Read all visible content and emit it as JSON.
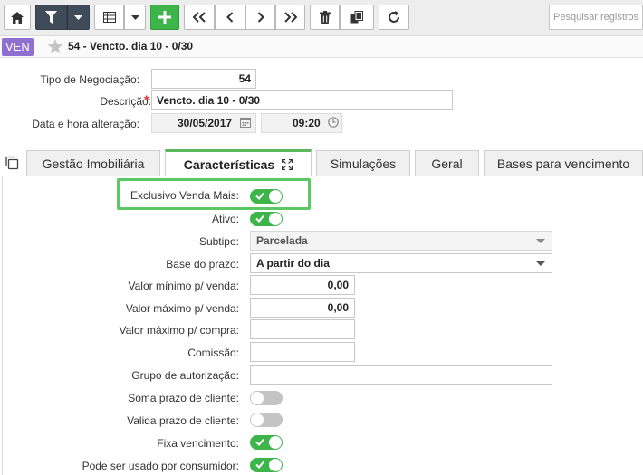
{
  "toolbar": {
    "search_placeholder": "Pesquisar registros..."
  },
  "titlebar": {
    "badge": "VEN",
    "title": "54 - Vencto. dia 10 - 0/30"
  },
  "header": {
    "tipo_label": "Tipo de Negociação:",
    "tipo_value": "54",
    "descricao_label": "Descrição:",
    "descricao_required": "*",
    "descricao_value": "Vencto. dia 10 - 0/30",
    "data_label": "Data e hora alteração:",
    "data_value": "30/05/2017",
    "hora_value": "09:20"
  },
  "tabs": [
    {
      "label": "Gestão Imobiliária"
    },
    {
      "label": "Características"
    },
    {
      "label": "Simulações"
    },
    {
      "label": "Geral"
    },
    {
      "label": "Bases para vencimento"
    }
  ],
  "form": {
    "exclusivo_label": "Exclusivo Venda Mais:",
    "exclusivo_on": true,
    "ativo_label": "Ativo:",
    "ativo_on": true,
    "subtipo_label": "Subtipo:",
    "subtipo_value": "Parcelada",
    "base_prazo_label": "Base do prazo:",
    "base_prazo_value": "A partir do dia",
    "valor_min_venda_label": "Valor mínimo p/ venda:",
    "valor_min_venda_value": "0,00",
    "valor_max_venda_label": "Valor máximo p/ venda:",
    "valor_max_venda_value": "0,00",
    "valor_max_compra_label": "Valor máximo p/ compra:",
    "valor_max_compra_value": "",
    "comissao_label": "Comissão:",
    "comissao_value": "",
    "grupo_label": "Grupo de autorização:",
    "grupo_value": "",
    "soma_prazo_label": "Soma prazo de cliente:",
    "soma_prazo_on": false,
    "valida_prazo_label": "Valida prazo de cliente:",
    "valida_prazo_on": false,
    "fixa_venc_label": "Fixa vencimento:",
    "fixa_venc_on": true,
    "consumidor_label": "Pode ser usado por consumidor:",
    "consumidor_on": true
  },
  "colors": {
    "accent_green": "#3eb54a",
    "badge_purple": "#8f6fd0",
    "toolbar_dark": "#3f4b58"
  }
}
